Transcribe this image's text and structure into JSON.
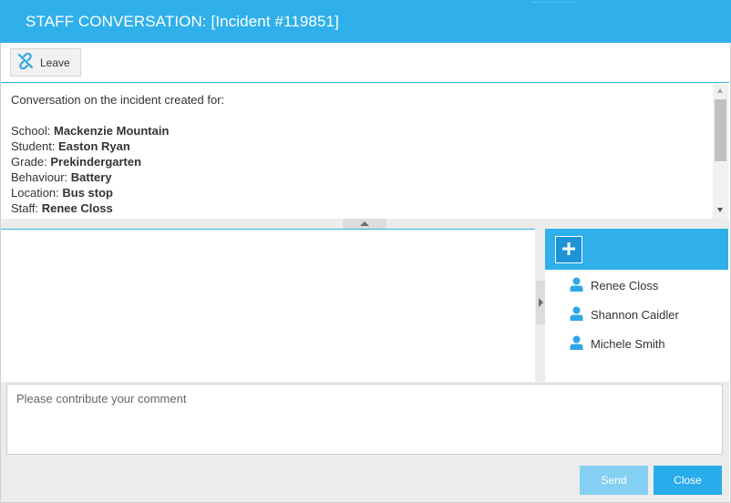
{
  "dialog": {
    "title": "STAFF CONVERSATION: [Incident #119851]"
  },
  "toolbar": {
    "leave_label": "Leave"
  },
  "incident": {
    "intro": "Conversation on the incident created for:",
    "rows": [
      {
        "label": "School: ",
        "value": "Mackenzie Mountain"
      },
      {
        "label": "Student: ",
        "value": "Easton Ryan"
      },
      {
        "label": "Grade: ",
        "value": "Prekindergarten"
      },
      {
        "label": "Behaviour: ",
        "value": "Battery"
      },
      {
        "label": "Location: ",
        "value": "Bus stop"
      },
      {
        "label": "Staff: ",
        "value": "Renee Closs"
      }
    ]
  },
  "participants": [
    {
      "name": "Renee Closs"
    },
    {
      "name": "Shannon Caidler"
    },
    {
      "name": "Michele Smith"
    }
  ],
  "comment": {
    "placeholder": "Please contribute your comment",
    "value": ""
  },
  "footer": {
    "send_label": "Send",
    "close_label": "Close"
  },
  "colors": {
    "accent": "#2fb0ea",
    "accent_dark": "#1e93d6",
    "send_disabled": "#85d0f2",
    "close": "#29acec",
    "panel_bg": "#ececec"
  },
  "icons": {
    "leave": "unlink-icon",
    "add": "plus-icon",
    "participant": "user-icon"
  }
}
